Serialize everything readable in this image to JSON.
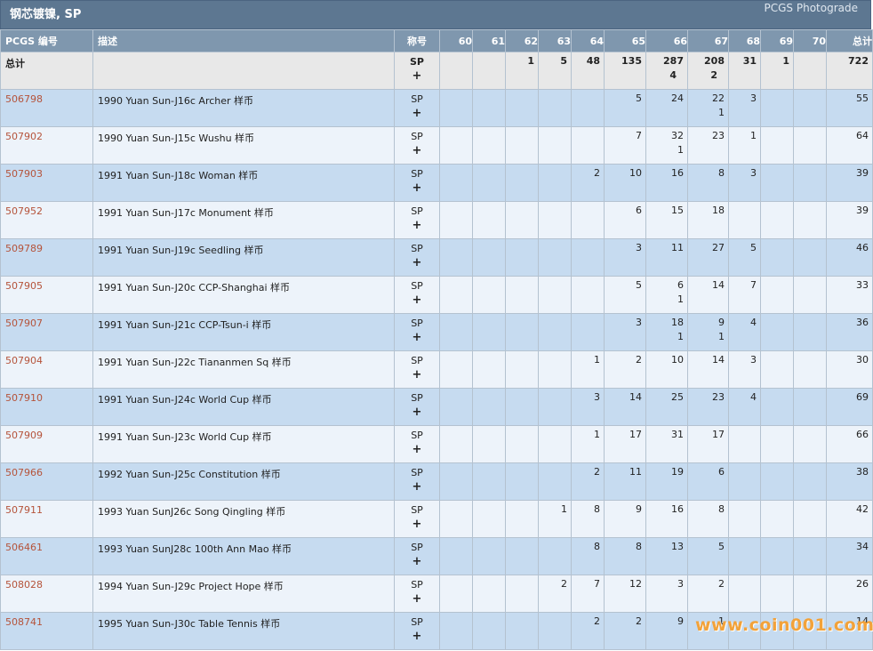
{
  "header": {
    "title": "钢芯镀镍, SP",
    "link": "PCGS Photograde"
  },
  "columns": [
    "PCGS 编号",
    "描述",
    "称号",
    "60",
    "61",
    "62",
    "63",
    "64",
    "65",
    "66",
    "67",
    "68",
    "69",
    "70",
    "总计"
  ],
  "totals": {
    "label": "总计",
    "designation": [
      "SP",
      "+"
    ],
    "grades": [
      [
        "",
        ""
      ],
      [
        "",
        ""
      ],
      [
        "1",
        ""
      ],
      [
        "5",
        ""
      ],
      [
        "48",
        ""
      ],
      [
        "135",
        ""
      ],
      [
        "287",
        "4"
      ],
      [
        "208",
        "2"
      ],
      [
        "31",
        ""
      ],
      [
        "1",
        ""
      ],
      [
        "",
        ""
      ]
    ],
    "total": "722"
  },
  "rows": [
    {
      "code": "506798",
      "desc": "1990 Yuan Sun-J16c Archer 样币",
      "designation": [
        "SP",
        "+"
      ],
      "grades": [
        [
          "",
          ""
        ],
        [
          "",
          ""
        ],
        [
          "",
          ""
        ],
        [
          "",
          ""
        ],
        [
          "",
          ""
        ],
        [
          "5",
          ""
        ],
        [
          "24",
          ""
        ],
        [
          "22",
          "1"
        ],
        [
          "3",
          ""
        ],
        [
          "",
          ""
        ],
        [
          "",
          ""
        ]
      ],
      "total": "55"
    },
    {
      "code": "507902",
      "desc": "1990 Yuan Sun-J15c Wushu 样币",
      "designation": [
        "SP",
        "+"
      ],
      "grades": [
        [
          "",
          ""
        ],
        [
          "",
          ""
        ],
        [
          "",
          ""
        ],
        [
          "",
          ""
        ],
        [
          "",
          ""
        ],
        [
          "7",
          ""
        ],
        [
          "32",
          "1"
        ],
        [
          "23",
          ""
        ],
        [
          "1",
          ""
        ],
        [
          "",
          ""
        ],
        [
          "",
          ""
        ]
      ],
      "total": "64"
    },
    {
      "code": "507903",
      "desc": "1991 Yuan Sun-J18c Woman 样币",
      "designation": [
        "SP",
        "+"
      ],
      "grades": [
        [
          "",
          ""
        ],
        [
          "",
          ""
        ],
        [
          "",
          ""
        ],
        [
          "",
          ""
        ],
        [
          "2",
          ""
        ],
        [
          "10",
          ""
        ],
        [
          "16",
          ""
        ],
        [
          "8",
          ""
        ],
        [
          "3",
          ""
        ],
        [
          "",
          ""
        ],
        [
          "",
          ""
        ]
      ],
      "total": "39"
    },
    {
      "code": "507952",
      "desc": "1991 Yuan Sun-J17c Monument 样币",
      "designation": [
        "SP",
        "+"
      ],
      "grades": [
        [
          "",
          ""
        ],
        [
          "",
          ""
        ],
        [
          "",
          ""
        ],
        [
          "",
          ""
        ],
        [
          "",
          ""
        ],
        [
          "6",
          ""
        ],
        [
          "15",
          ""
        ],
        [
          "18",
          ""
        ],
        [
          "",
          ""
        ],
        [
          "",
          ""
        ],
        [
          "",
          ""
        ]
      ],
      "total": "39"
    },
    {
      "code": "509789",
      "desc": "1991 Yuan Sun-J19c Seedling 样币",
      "designation": [
        "SP",
        "+"
      ],
      "grades": [
        [
          "",
          ""
        ],
        [
          "",
          ""
        ],
        [
          "",
          ""
        ],
        [
          "",
          ""
        ],
        [
          "",
          ""
        ],
        [
          "3",
          ""
        ],
        [
          "11",
          ""
        ],
        [
          "27",
          ""
        ],
        [
          "5",
          ""
        ],
        [
          "",
          ""
        ],
        [
          "",
          ""
        ]
      ],
      "total": "46"
    },
    {
      "code": "507905",
      "desc": "1991 Yuan Sun-J20c CCP-Shanghai 样币",
      "designation": [
        "SP",
        "+"
      ],
      "grades": [
        [
          "",
          ""
        ],
        [
          "",
          ""
        ],
        [
          "",
          ""
        ],
        [
          "",
          ""
        ],
        [
          "",
          ""
        ],
        [
          "5",
          ""
        ],
        [
          "6",
          "1"
        ],
        [
          "14",
          ""
        ],
        [
          "7",
          ""
        ],
        [
          "",
          ""
        ],
        [
          "",
          ""
        ]
      ],
      "total": "33"
    },
    {
      "code": "507907",
      "desc": "1991 Yuan Sun-J21c CCP-Tsun-i 样币",
      "designation": [
        "SP",
        "+"
      ],
      "grades": [
        [
          "",
          ""
        ],
        [
          "",
          ""
        ],
        [
          "",
          ""
        ],
        [
          "",
          ""
        ],
        [
          "",
          ""
        ],
        [
          "3",
          ""
        ],
        [
          "18",
          "1"
        ],
        [
          "9",
          "1"
        ],
        [
          "4",
          ""
        ],
        [
          "",
          ""
        ],
        [
          "",
          ""
        ]
      ],
      "total": "36"
    },
    {
      "code": "507904",
      "desc": "1991 Yuan Sun-J22c Tiananmen Sq 样币",
      "designation": [
        "SP",
        "+"
      ],
      "grades": [
        [
          "",
          ""
        ],
        [
          "",
          ""
        ],
        [
          "",
          ""
        ],
        [
          "",
          ""
        ],
        [
          "1",
          ""
        ],
        [
          "2",
          ""
        ],
        [
          "10",
          ""
        ],
        [
          "14",
          ""
        ],
        [
          "3",
          ""
        ],
        [
          "",
          ""
        ],
        [
          "",
          ""
        ]
      ],
      "total": "30"
    },
    {
      "code": "507910",
      "desc": "1991 Yuan Sun-J24c World Cup 样币",
      "designation": [
        "SP",
        "+"
      ],
      "grades": [
        [
          "",
          ""
        ],
        [
          "",
          ""
        ],
        [
          "",
          ""
        ],
        [
          "",
          ""
        ],
        [
          "3",
          ""
        ],
        [
          "14",
          ""
        ],
        [
          "25",
          ""
        ],
        [
          "23",
          ""
        ],
        [
          "4",
          ""
        ],
        [
          "",
          ""
        ],
        [
          "",
          ""
        ]
      ],
      "total": "69"
    },
    {
      "code": "507909",
      "desc": "1991 Yuan Sun-J23c World Cup 样币",
      "designation": [
        "SP",
        "+"
      ],
      "grades": [
        [
          "",
          ""
        ],
        [
          "",
          ""
        ],
        [
          "",
          ""
        ],
        [
          "",
          ""
        ],
        [
          "1",
          ""
        ],
        [
          "17",
          ""
        ],
        [
          "31",
          ""
        ],
        [
          "17",
          ""
        ],
        [
          "",
          ""
        ],
        [
          "",
          ""
        ],
        [
          "",
          ""
        ]
      ],
      "total": "66"
    },
    {
      "code": "507966",
      "desc": "1992 Yuan Sun-J25c Constitution 样币",
      "designation": [
        "SP",
        "+"
      ],
      "grades": [
        [
          "",
          ""
        ],
        [
          "",
          ""
        ],
        [
          "",
          ""
        ],
        [
          "",
          ""
        ],
        [
          "2",
          ""
        ],
        [
          "11",
          ""
        ],
        [
          "19",
          ""
        ],
        [
          "6",
          ""
        ],
        [
          "",
          ""
        ],
        [
          "",
          ""
        ],
        [
          "",
          ""
        ]
      ],
      "total": "38"
    },
    {
      "code": "507911",
      "desc": "1993 Yuan SunJ26c Song Qingling 样币",
      "designation": [
        "SP",
        "+"
      ],
      "grades": [
        [
          "",
          ""
        ],
        [
          "",
          ""
        ],
        [
          "",
          ""
        ],
        [
          "1",
          ""
        ],
        [
          "8",
          ""
        ],
        [
          "9",
          ""
        ],
        [
          "16",
          ""
        ],
        [
          "8",
          ""
        ],
        [
          "",
          ""
        ],
        [
          "",
          ""
        ],
        [
          "",
          ""
        ]
      ],
      "total": "42"
    },
    {
      "code": "506461",
      "desc": "1993 Yuan SunJ28c 100th Ann Mao 样币",
      "designation": [
        "SP",
        "+"
      ],
      "grades": [
        [
          "",
          ""
        ],
        [
          "",
          ""
        ],
        [
          "",
          ""
        ],
        [
          "",
          ""
        ],
        [
          "8",
          ""
        ],
        [
          "8",
          ""
        ],
        [
          "13",
          ""
        ],
        [
          "5",
          ""
        ],
        [
          "",
          ""
        ],
        [
          "",
          ""
        ],
        [
          "",
          ""
        ]
      ],
      "total": "34"
    },
    {
      "code": "508028",
      "desc": "1994 Yuan Sun-J29c Project Hope 样币",
      "designation": [
        "SP",
        "+"
      ],
      "grades": [
        [
          "",
          ""
        ],
        [
          "",
          ""
        ],
        [
          "",
          ""
        ],
        [
          "2",
          ""
        ],
        [
          "7",
          ""
        ],
        [
          "12",
          ""
        ],
        [
          "3",
          ""
        ],
        [
          "2",
          ""
        ],
        [
          "",
          ""
        ],
        [
          "",
          ""
        ],
        [
          "",
          ""
        ]
      ],
      "total": "26"
    },
    {
      "code": "508741",
      "desc": "1995 Yuan Sun-J30c Table Tennis 样币",
      "designation": [
        "SP",
        "+"
      ],
      "grades": [
        [
          "",
          ""
        ],
        [
          "",
          ""
        ],
        [
          "",
          ""
        ],
        [
          "",
          ""
        ],
        [
          "2",
          ""
        ],
        [
          "2",
          ""
        ],
        [
          "9",
          ""
        ],
        [
          "1",
          ""
        ],
        [
          "",
          ""
        ],
        [
          "",
          ""
        ],
        [
          "",
          ""
        ]
      ],
      "total": "14"
    }
  ],
  "watermark": "www.coin001.com"
}
